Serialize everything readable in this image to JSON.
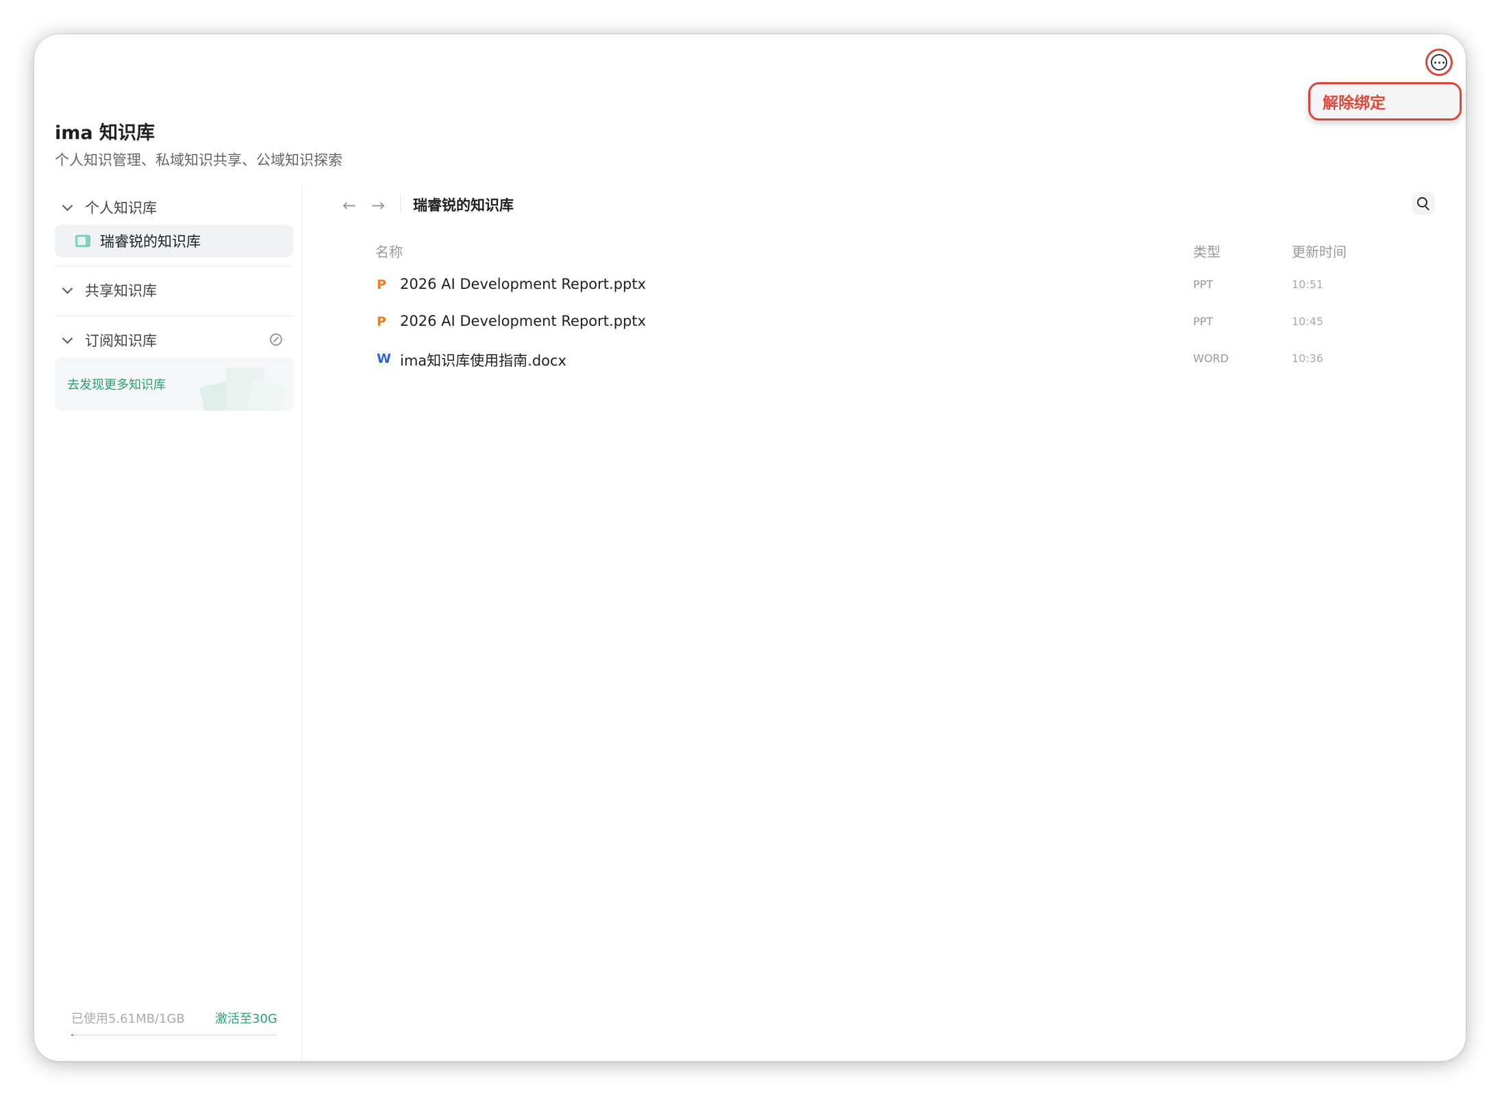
{
  "header": {
    "more_icon": "more-horizontal-icon",
    "unbind_label": "解除绑定"
  },
  "app": {
    "title": "ima 知识库",
    "subtitle": "个人知识管理、私域知识共享、公域知识探索"
  },
  "sidebar": {
    "personal": {
      "label": "个人知识库",
      "items": [
        {
          "label": "瑞睿锐的知识库"
        }
      ]
    },
    "shared": {
      "label": "共享知识库"
    },
    "subscribed": {
      "label": "订阅知识库",
      "icon": "compass-icon"
    },
    "discover_label": "去发现更多知识库",
    "storage": {
      "used": "已使用5.61MB/1GB",
      "activate": "激活至30G",
      "fill_fraction": 0.0055
    }
  },
  "main": {
    "breadcrumb": "瑞睿锐的知识库",
    "columns": {
      "name": "名称",
      "type": "类型",
      "updated": "更新时间"
    },
    "files": [
      {
        "icon": "P",
        "icon_color": "#f07a22",
        "name": "2026 AI Development Report.pptx",
        "type": "PPT",
        "time": "10:51"
      },
      {
        "icon": "P",
        "icon_color": "#f07a22",
        "name": "2026 AI Development Report.pptx",
        "type": "PPT",
        "time": "10:45"
      },
      {
        "icon": "W",
        "icon_color": "#2b63e6",
        "name": "ima知识库使用指南.docx",
        "type": "WORD",
        "time": "10:36"
      }
    ]
  },
  "colors": {
    "accent": "#2ba471",
    "highlight": "#d8473b"
  }
}
